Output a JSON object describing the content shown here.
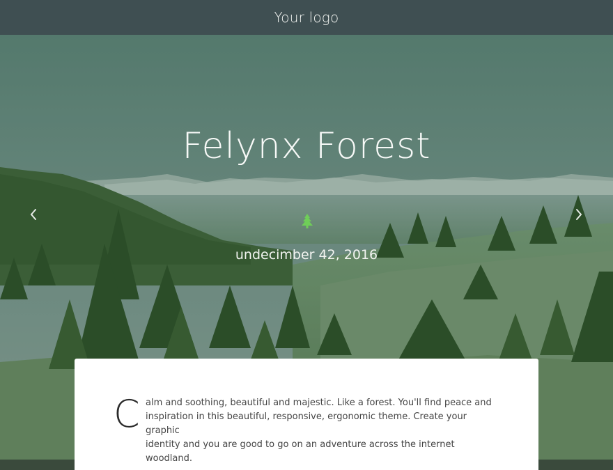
{
  "header": {
    "logo": "Your logo"
  },
  "hero": {
    "title": "Felynx Forest",
    "date": "undecimber 42, 2016",
    "prev_icon": "chevron-left-icon",
    "next_icon": "chevron-right-icon",
    "divider_icon": "tree-icon",
    "accent_color": "#6fce58"
  },
  "intro": {
    "dropcap": "C",
    "lines": [
      "alm and soothing, beautiful and majestic. Like a forest. You'll find peace and",
      "inspiration in this beautiful, responsive, ergonomic theme. Create your graphic",
      "identity and you are good to go on an adventure across the internet woodland."
    ]
  }
}
